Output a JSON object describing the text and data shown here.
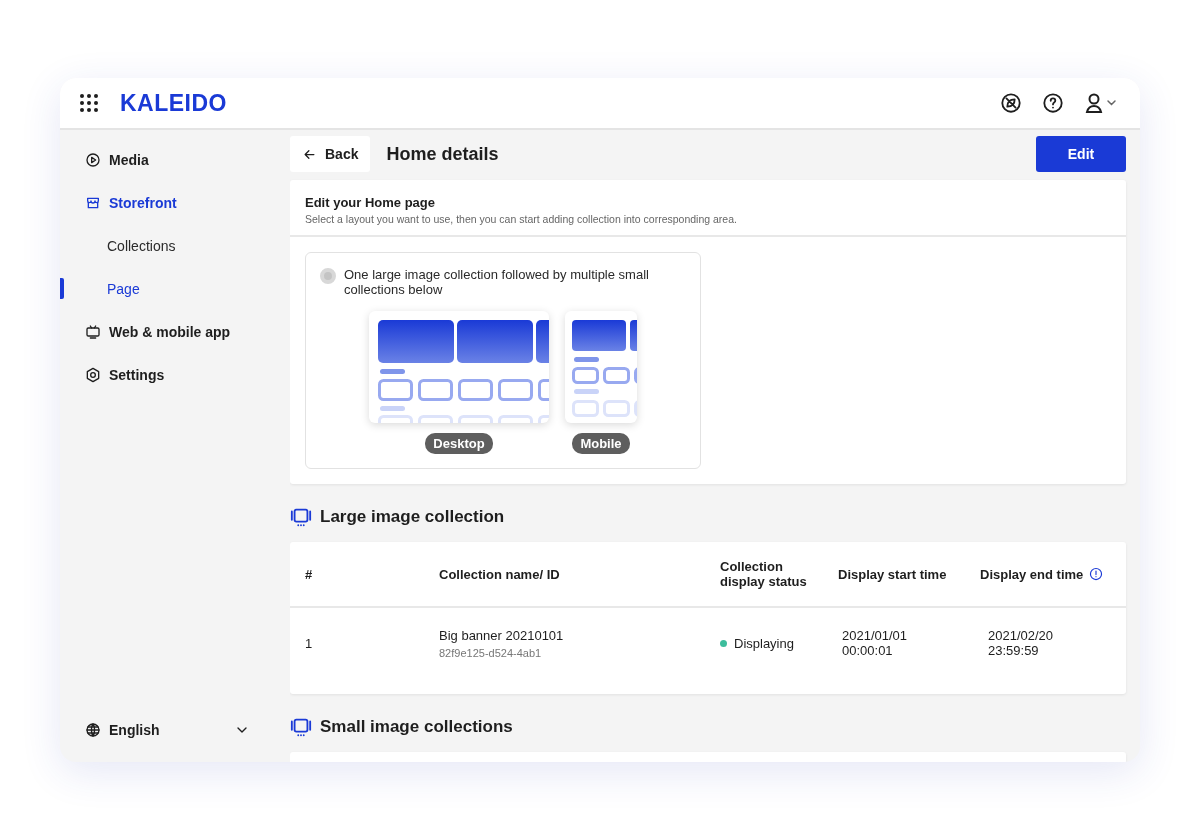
{
  "app": {
    "logo": "KALEIDO"
  },
  "sidebar": {
    "items": [
      {
        "label": "Media",
        "kind": "media",
        "selected": false
      },
      {
        "label": "Storefront",
        "kind": "store",
        "selected": true,
        "children": [
          {
            "label": "Collections",
            "selected": false
          },
          {
            "label": "Page",
            "selected": true
          }
        ]
      },
      {
        "label": "Web & mobile app",
        "kind": "app",
        "selected": false
      },
      {
        "label": "Settings",
        "kind": "settings",
        "selected": false
      }
    ],
    "language": "English"
  },
  "toolbar": {
    "back": "Back",
    "title": "Home details",
    "edit": "Edit"
  },
  "layout_card": {
    "title": "Edit your Home page",
    "subtitle": "Select a layout you want to use, then you can start adding collection into corresponding area.",
    "option": {
      "label": "One large image collection followed by multiple small collections below",
      "selected": true,
      "disabled": true
    },
    "previews": [
      "Desktop",
      "Mobile"
    ]
  },
  "large_section": {
    "title": "Large image collection",
    "table": {
      "columns": [
        "#",
        "Collection name/ ID",
        "Collection display status",
        "Display start time",
        "Display end time"
      ],
      "rows": [
        {
          "index": "1",
          "name": "Big banner 20210101",
          "id": "82f9e125-d524-4ab1",
          "status": "Displaying",
          "color": "#3dbd9c",
          "start": [
            "2021/01/01",
            "00:00:01"
          ],
          "end": [
            "2021/02/20",
            "23:59:59"
          ]
        }
      ]
    }
  },
  "small_section": {
    "title": "Small image collections"
  }
}
